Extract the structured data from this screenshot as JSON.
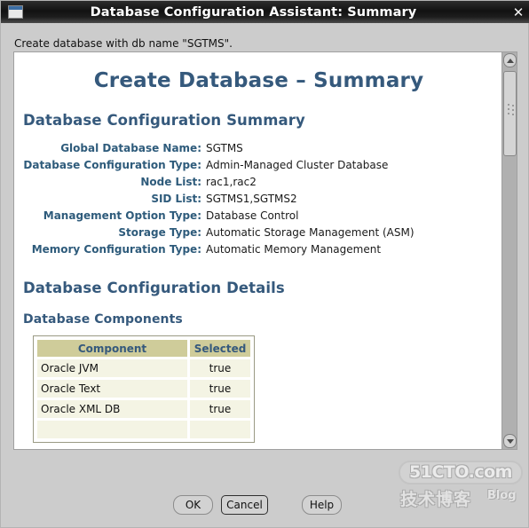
{
  "window": {
    "title": "Database Configuration Assistant: Summary",
    "icon": "window-icon",
    "close_label": "✕"
  },
  "subcaption": "Create database with db name \"SGTMS\".",
  "document": {
    "title": "Create Database – Summary",
    "section_summary_heading": "Database Configuration Summary",
    "summary_rows": [
      {
        "label": "Global Database Name:",
        "value": "SGTMS"
      },
      {
        "label": "Database Configuration Type:",
        "value": "Admin-Managed Cluster Database"
      },
      {
        "label": "Node List:",
        "value": "rac1,rac2"
      },
      {
        "label": "SID List:",
        "value": "SGTMS1,SGTMS2"
      },
      {
        "label": "Management Option Type:",
        "value": "Database Control"
      },
      {
        "label": "Storage Type:",
        "value": "Automatic Storage Management (ASM)"
      },
      {
        "label": "Memory Configuration Type:",
        "value": "Automatic Memory Management"
      }
    ],
    "section_details_heading": "Database Configuration Details",
    "section_components_heading": "Database Components",
    "components_table": {
      "headers": [
        "Component",
        "Selected"
      ],
      "rows": [
        {
          "component": "Oracle JVM",
          "selected": "true"
        },
        {
          "component": "Oracle Text",
          "selected": "true"
        },
        {
          "component": "Oracle XML DB",
          "selected": "true"
        },
        {
          "component": "",
          "selected": ""
        }
      ]
    }
  },
  "scrollbar": {
    "up_arrow": "scroll-up-arrow",
    "down_arrow": "scroll-down-arrow"
  },
  "watermark": {
    "site": "51CTO.com",
    "chinese": "技术博客",
    "blog": "Blog"
  },
  "buttons": {
    "ok": "OK",
    "cancel": "Cancel",
    "help": "Help"
  },
  "colors": {
    "heading": "#35597c",
    "label": "#2e5b7b",
    "table_header_bg": "#cfcc9a",
    "table_cell_bg": "#f4f4e4",
    "window_bg": "#cccccc",
    "titlebar_bg": "#121212"
  }
}
